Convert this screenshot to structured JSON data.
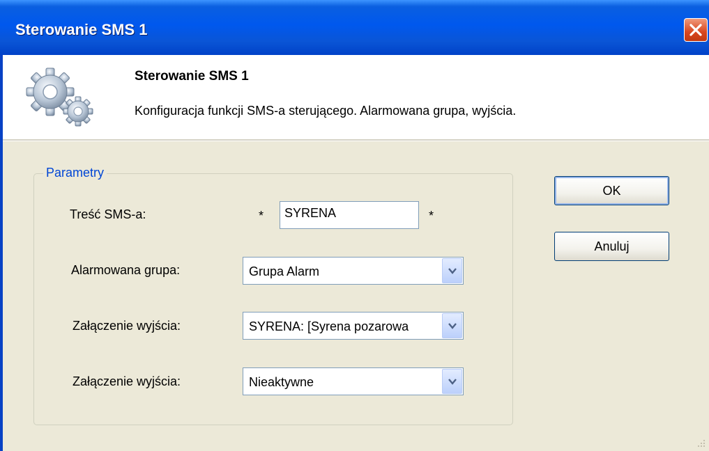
{
  "window": {
    "title": "Sterowanie SMS 1"
  },
  "header": {
    "title": "Sterowanie SMS 1",
    "description": "Konfiguracja funkcji SMS-a sterującego. Alarmowana grupa, wyjścia."
  },
  "group": {
    "legend": "Parametry"
  },
  "sms_content": {
    "label": "Treść SMS-a:",
    "prefix": "*",
    "value": "SYRENA",
    "suffix": "*"
  },
  "alarm_group": {
    "label": "Alarmowana grupa:",
    "selected": "Grupa Alarm"
  },
  "output1": {
    "label": "Załączenie wyjścia:",
    "selected": "SYRENA: [Syrena pozarowa"
  },
  "output2": {
    "label": "Załączenie wyjścia:",
    "selected": "Nieaktywne"
  },
  "buttons": {
    "ok": "OK",
    "cancel": "Anuluj"
  },
  "colors": {
    "titlebar": "#0058ee",
    "dialog_bg": "#ece9d8",
    "legend_text": "#0046d5",
    "close_button": "#d8461f"
  }
}
